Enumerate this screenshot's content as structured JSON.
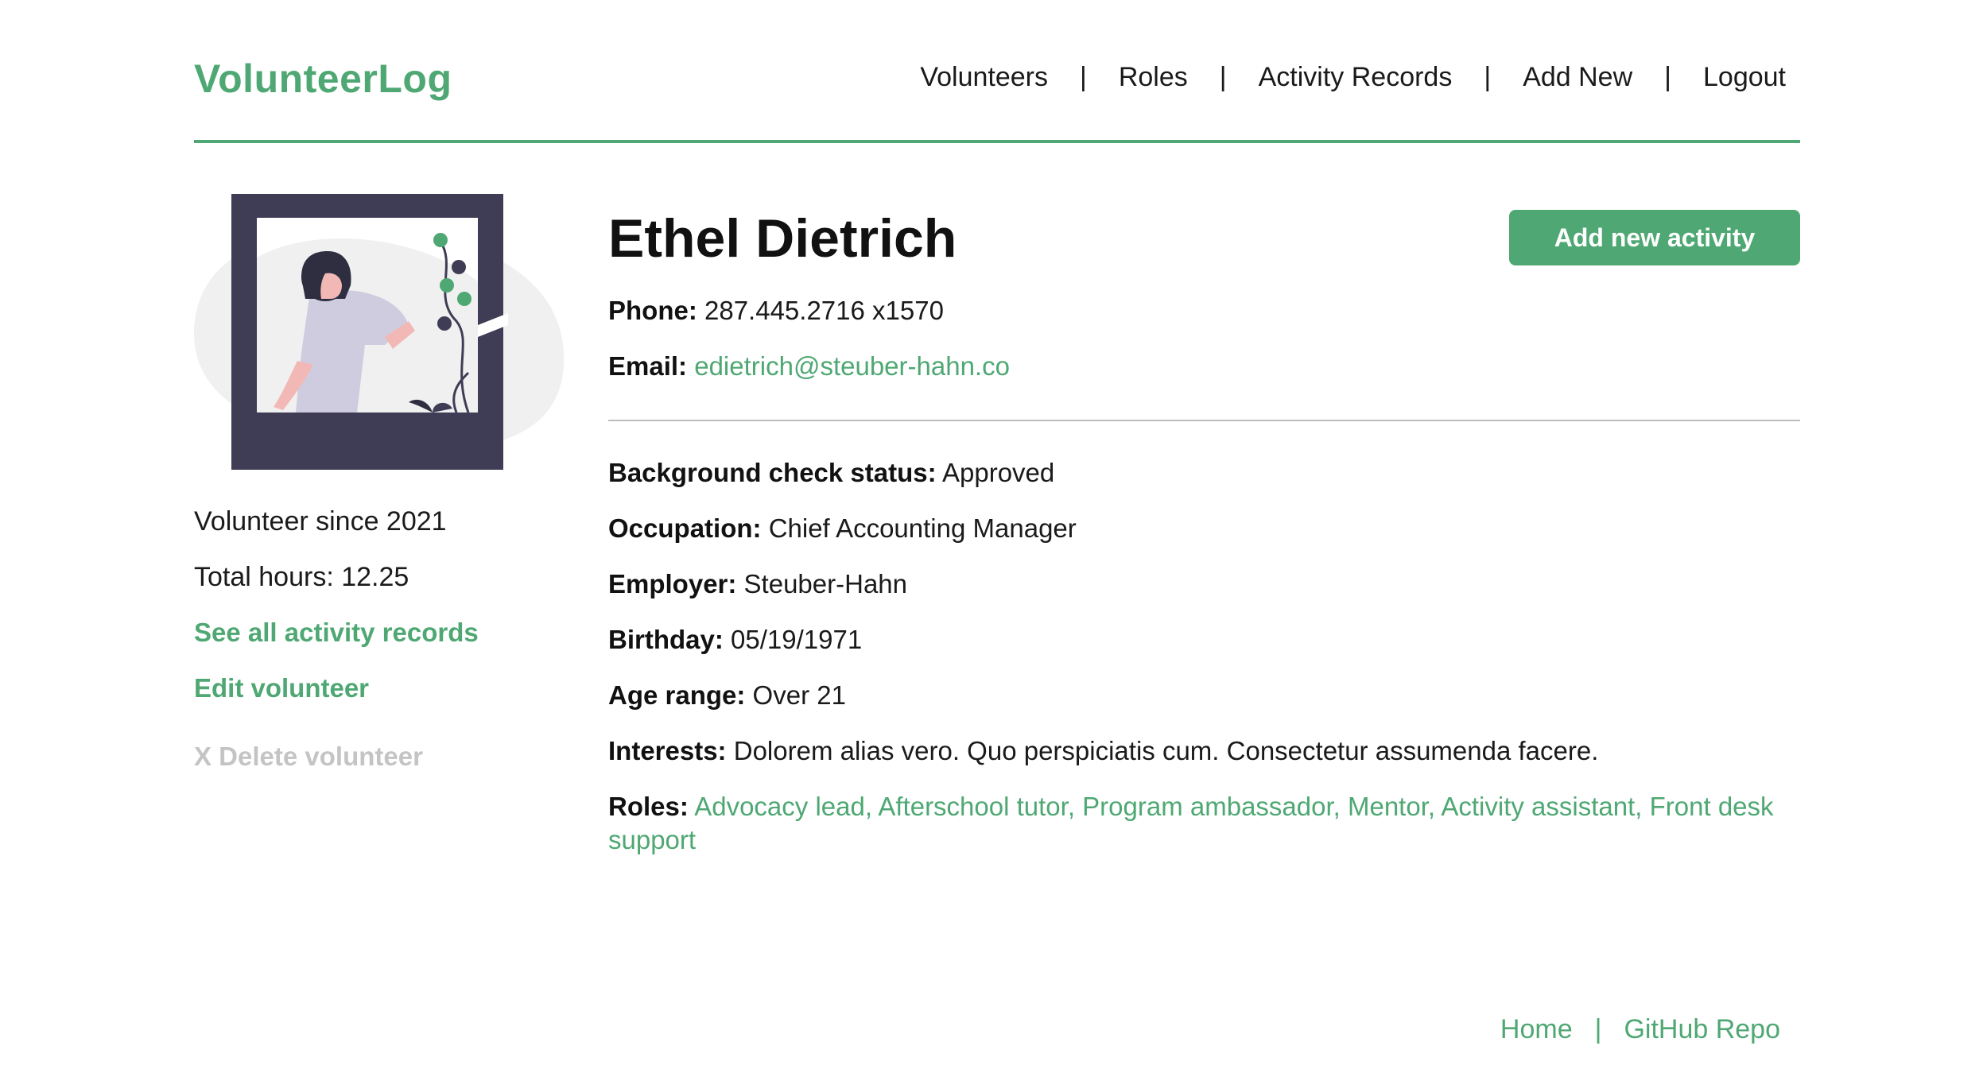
{
  "header": {
    "brand": "VolunteerLog",
    "nav": {
      "volunteers": "Volunteers",
      "roles": "Roles",
      "activity_records": "Activity Records",
      "add_new": "Add New",
      "logout": "Logout",
      "separator": "|"
    }
  },
  "sidebar": {
    "volunteer_since": "Volunteer since 2021",
    "total_hours": "Total hours: 12.25",
    "see_all_link": "See all activity records",
    "edit_link": "Edit volunteer",
    "delete_link": "X Delete volunteer"
  },
  "profile": {
    "name": "Ethel Dietrich",
    "add_activity_button": "Add new activity",
    "phone_label": "Phone:",
    "phone": "287.445.2716 x1570",
    "email_label": "Email:",
    "email": "edietrich@steuber-hahn.co",
    "background_label": "Background check status:",
    "background": "Approved",
    "occupation_label": "Occupation:",
    "occupation": "Chief Accounting Manager",
    "employer_label": "Employer:",
    "employer": "Steuber-Hahn",
    "birthday_label": "Birthday:",
    "birthday": "05/19/1971",
    "age_label": "Age range:",
    "age": "Over 21",
    "interests_label": "Interests:",
    "interests": "Dolorem alias vero. Quo perspiciatis cum. Consectetur assumenda facere.",
    "roles_label": "Roles:",
    "roles": "Advocacy lead, Afterschool tutor, Program ambassador, Mentor, Activity assistant, Front desk support"
  },
  "footer": {
    "home": "Home",
    "github": "GitHub Repo",
    "separator": "|"
  },
  "colors": {
    "accent": "#4fa873",
    "frame_dark": "#3f3d56",
    "muted": "#c4c4c4"
  }
}
